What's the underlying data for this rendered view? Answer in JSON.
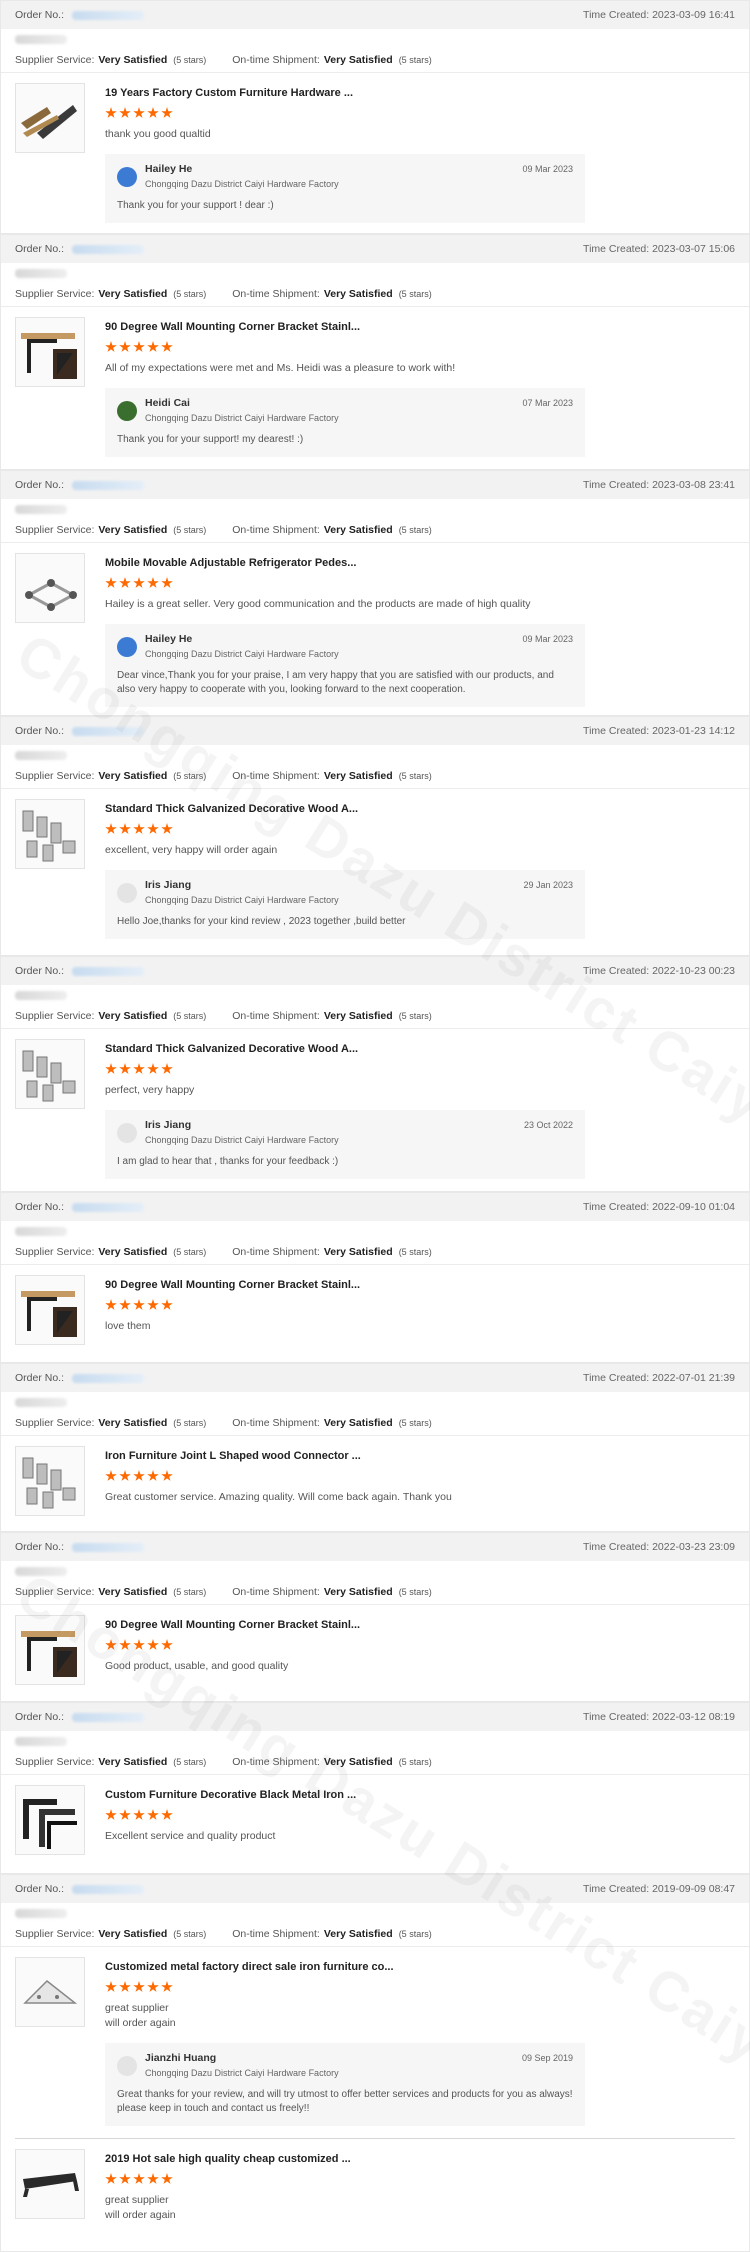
{
  "labels": {
    "order_no": "Order No.:",
    "supplier_service": "Supplier Service:",
    "on_time_shipment": "On-time Shipment:",
    "very_satisfied": "Very Satisfied",
    "five_stars": "(5 stars)"
  },
  "watermark": "Chongqing Dazu District Caiyi Hardware Factory",
  "orders": [
    {
      "time": "Time Created: 2023-03-09 16:41",
      "items": [
        {
          "title": "19 Years Factory Custom Furniture Hardware ...",
          "rating": 5,
          "comment": "thank you good qualtid",
          "reply": {
            "name": "Hailey He",
            "company": "Chongqing Dazu District Caiyi Hardware Factory",
            "date": "09 Mar 2023",
            "text": "Thank you for your support ! dear :)"
          }
        }
      ]
    },
    {
      "time": "Time Created: 2023-03-07 15:06",
      "items": [
        {
          "title": "90 Degree Wall Mounting Corner Bracket Stainl...",
          "rating": 5,
          "comment": "All of my expectations were met and Ms. Heidi was a pleasure to work with!",
          "reply": {
            "name": "Heidi Cai",
            "company": "Chongqing Dazu District Caiyi Hardware Factory",
            "date": "07 Mar 2023",
            "text": "Thank you for your support! my dearest! :)"
          }
        }
      ]
    },
    {
      "time": "Time Created: 2023-03-08 23:41",
      "items": [
        {
          "title": "Mobile Movable Adjustable Refrigerator Pedes...",
          "rating": 5,
          "comment": "Hailey is a great seller. Very good communication and the products are made of high quality",
          "reply": {
            "name": "Hailey He",
            "company": "Chongqing Dazu District Caiyi Hardware Factory",
            "date": "09 Mar 2023",
            "text": "Dear vince,Thank you for your praise, I am very happy that you are satisfied with our products, and also very happy to cooperate with you, looking forward to the next cooperation."
          }
        }
      ]
    },
    {
      "time": "Time Created: 2023-01-23 14:12",
      "items": [
        {
          "title": "Standard Thick Galvanized Decorative Wood A...",
          "rating": 5,
          "comment": "excellent, very happy will order again",
          "reply": {
            "name": "Iris Jiang",
            "company": "Chongqing Dazu District Caiyi Hardware Factory",
            "date": "29 Jan 2023",
            "text": "Hello Joe,thanks for your kind review , 2023 together ,build better"
          }
        }
      ]
    },
    {
      "time": "Time Created: 2022-10-23 00:23",
      "items": [
        {
          "title": "Standard Thick Galvanized Decorative Wood A...",
          "rating": 5,
          "comment": "perfect, very happy",
          "reply": {
            "name": "Iris Jiang",
            "company": "Chongqing Dazu District Caiyi Hardware Factory",
            "date": "23 Oct 2022",
            "text": "I am glad to hear that , thanks for your feedback :)"
          }
        }
      ]
    },
    {
      "time": "Time Created: 2022-09-10 01:04",
      "items": [
        {
          "title": "90 Degree Wall Mounting Corner Bracket Stainl...",
          "rating": 5,
          "comment": "love them"
        }
      ]
    },
    {
      "time": "Time Created: 2022-07-01 21:39",
      "items": [
        {
          "title": "Iron Furniture Joint L Shaped wood Connector ...",
          "rating": 5,
          "comment": "Great customer service. Amazing quality. Will come back again. Thank you"
        }
      ]
    },
    {
      "time": "Time Created: 2022-03-23 23:09",
      "items": [
        {
          "title": "90 Degree Wall Mounting Corner Bracket Stainl...",
          "rating": 5,
          "comment": "Good product, usable, and good quality"
        }
      ]
    },
    {
      "time": "Time Created: 2022-03-12 08:19",
      "items": [
        {
          "title": "Custom Furniture Decorative Black Metal Iron ...",
          "rating": 5,
          "comment": "Excellent service and quality product"
        }
      ]
    },
    {
      "time": "Time Created: 2019-09-09 08:47",
      "items": [
        {
          "title": "Customized metal factory direct sale iron furniture co...",
          "rating": 5,
          "comment": "great supplier\nwill order again",
          "reply": {
            "name": "Jianzhi Huang",
            "company": "Chongqing Dazu District Caiyi Hardware Factory",
            "date": "09 Sep 2019",
            "text": "Great thanks for your review, and will try utmost to offer better services and products for you as always! please keep in touch and contact us freely!!"
          }
        },
        {
          "title": "2019 Hot sale high quality cheap customized ...",
          "rating": 5,
          "comment": "great supplier\nwill order again"
        }
      ]
    }
  ]
}
